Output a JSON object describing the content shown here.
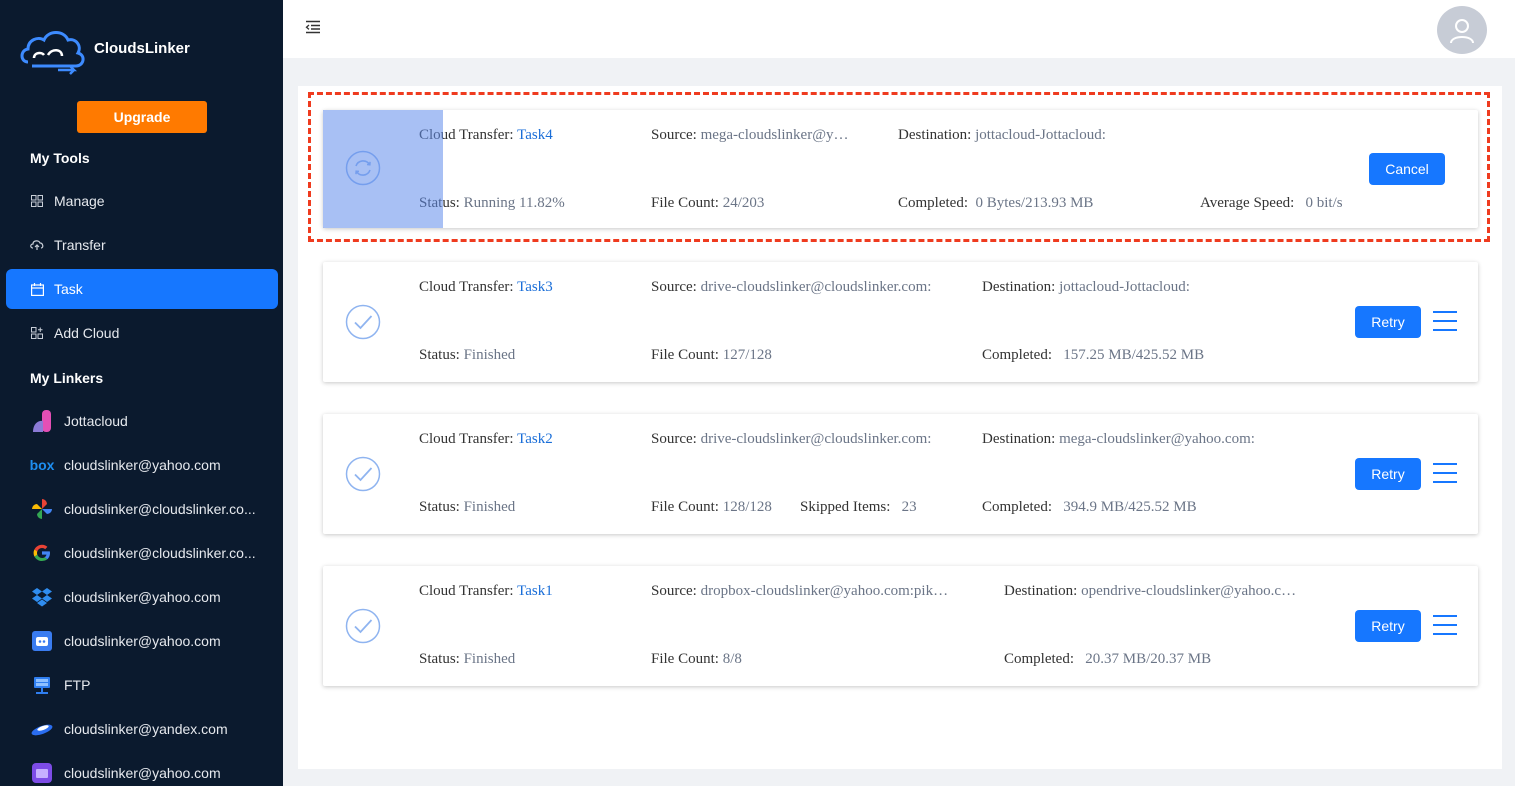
{
  "app": {
    "name": "CloudsLinker",
    "upgrade_label": "Upgrade",
    "brand_color": "#1677ff",
    "upgrade_color": "#ff7a00"
  },
  "sidebar": {
    "tools_title": "My Tools",
    "tools": [
      {
        "label": "Manage",
        "icon": "grid-icon"
      },
      {
        "label": "Transfer",
        "icon": "cloud-transfer-icon"
      },
      {
        "label": "Task",
        "icon": "calendar-icon",
        "active": true
      },
      {
        "label": "Add Cloud",
        "icon": "add-grid-icon"
      }
    ],
    "linkers_title": "My Linkers",
    "linkers": [
      {
        "label": "Jottacloud",
        "icon": "jottacloud-icon"
      },
      {
        "label": "cloudslinker@yahoo.com",
        "icon": "box-icon"
      },
      {
        "label": "cloudslinker@cloudslinker.co...",
        "icon": "google-photos-icon"
      },
      {
        "label": "cloudslinker@cloudslinker.co...",
        "icon": "google-icon"
      },
      {
        "label": "cloudslinker@yahoo.com",
        "icon": "dropbox-icon"
      },
      {
        "label": "cloudslinker@yahoo.com",
        "icon": "opendrive-icon"
      },
      {
        "label": "FTP",
        "icon": "ftp-icon"
      },
      {
        "label": "cloudslinker@yandex.com",
        "icon": "yandex-icon"
      },
      {
        "label": "cloudslinker@yahoo.com",
        "icon": "pcloud-icon"
      }
    ]
  },
  "tasks": [
    {
      "transfer_label": "Cloud Transfer:",
      "name": "Task4",
      "source_label": "Source:",
      "source": "mega-cloudslinker@y…",
      "destination_label": "Destination:",
      "destination": "jottacloud-Jottacloud:",
      "status_label": "Status:",
      "status": "Running 11.82%",
      "file_count_label": "File Count:",
      "file_count": "24/203",
      "completed_label": "Completed:",
      "completed": "0 Bytes/213.93 MB",
      "speed_label": "Average Speed:",
      "speed": "0 bit/s",
      "action_label": "Cancel",
      "state": "running"
    },
    {
      "transfer_label": "Cloud Transfer:",
      "name": "Task3",
      "source_label": "Source:",
      "source": "drive-cloudslinker@cloudslinker.com:",
      "destination_label": "Destination:",
      "destination": "jottacloud-Jottacloud:",
      "status_label": "Status:",
      "status": "Finished",
      "file_count_label": "File Count:",
      "file_count": "127/128",
      "completed_label": "Completed:",
      "completed": "157.25 MB/425.52 MB",
      "action_label": "Retry",
      "state": "finished"
    },
    {
      "transfer_label": "Cloud Transfer:",
      "name": "Task2",
      "source_label": "Source:",
      "source": "drive-cloudslinker@cloudslinker.com:",
      "destination_label": "Destination:",
      "destination": "mega-cloudslinker@yahoo.com:",
      "status_label": "Status:",
      "status": "Finished",
      "file_count_label": "File Count:",
      "file_count": "128/128",
      "skipped_label": "Skipped Items:",
      "skipped": "23",
      "completed_label": "Completed:",
      "completed": "394.9 MB/425.52 MB",
      "action_label": "Retry",
      "state": "finished"
    },
    {
      "transfer_label": "Cloud Transfer:",
      "name": "Task1",
      "source_label": "Source:",
      "source": "dropbox-cloudslinker@yahoo.com:pik…",
      "destination_label": "Destination:",
      "destination": "opendrive-cloudslinker@yahoo.c…",
      "status_label": "Status:",
      "status": "Finished",
      "file_count_label": "File Count:",
      "file_count": "8/8",
      "completed_label": "Completed:",
      "completed": "20.37 MB/20.37 MB",
      "action_label": "Retry",
      "state": "finished"
    }
  ]
}
